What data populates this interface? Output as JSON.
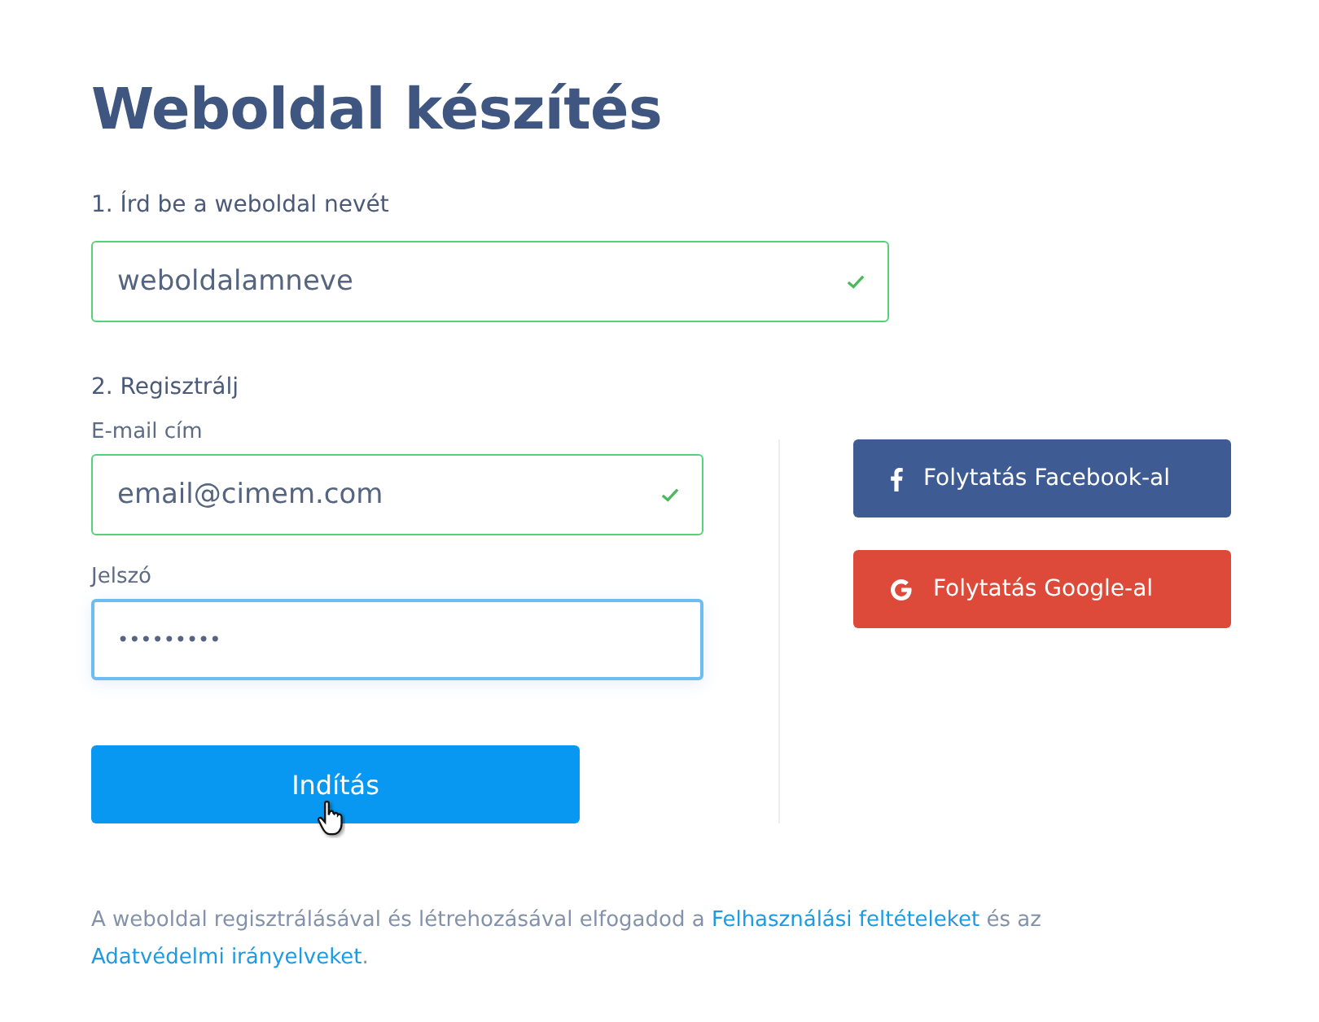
{
  "title": "Weboldal készítés",
  "step1": {
    "heading": "1. Írd be a weboldal nevét",
    "field": {
      "value": "weboldalamneve",
      "valid": true,
      "focused": false
    }
  },
  "step2": {
    "heading": "2. Regisztrálj",
    "fields": [
      {
        "label": "E-mail cím",
        "value": "email@cimem.com",
        "valid": true,
        "focused": false,
        "kind": "text"
      },
      {
        "label": "Jelszó",
        "value": "•••••••••",
        "valid": false,
        "focused": true,
        "kind": "password"
      }
    ],
    "submit": "Indítás",
    "social": [
      {
        "kind": "facebook",
        "label": "Folytatás Facebook-al"
      },
      {
        "kind": "google",
        "label": "Folytatás Google-al"
      }
    ]
  },
  "footer": {
    "text_before": "A weboldal regisztrálásával és létrehozásával elfogadod a",
    "link1": "Felhasználási feltételeket",
    "text_middle": "és az",
    "link2": "Adatvédelmi irányelveket",
    "text_after": "."
  }
}
